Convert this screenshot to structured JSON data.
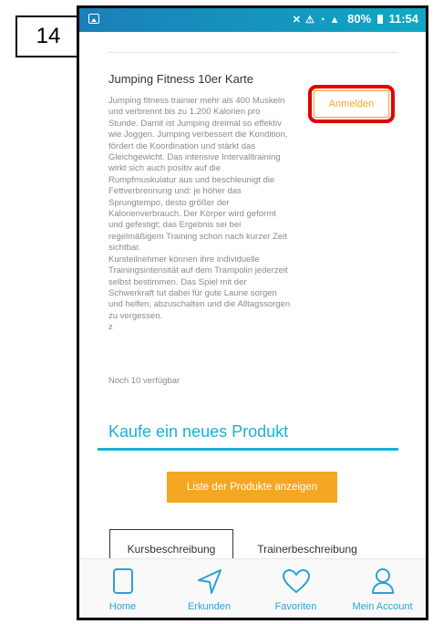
{
  "step_number": "14",
  "statusbar": {
    "signal_icons": "✕ ⚠ ◔ ▲",
    "battery": "80%",
    "time": "11:54"
  },
  "product": {
    "title": "Jumping Fitness 10er Karte",
    "description": "Jumping fitness trainier mehr als 400 Muskeln\nund  verbrennt bis zu 1.200 Kalorien pro\nStunde. Damit ist Jumping dreimal so  effektiv\nwie Joggen. Jumping verbessert die Kondition,\nfördert die  Koordination und stärkt das\nGleichgewicht. Das intensive Intervalltraining\nwirkt  sich auch positiv auf die\nRumpfmuskulatur aus und beschleunigt die\n Fettverbrennung und: je höher das\nSprungtempo, desto größer der\n Kalorienverbrauch. Der Körper wird geformt\nund gefestigt; das Ergebnis sei  bei\nregelmäßigem Training schon nach kurzer Zeit\nsichtbar.\nKursteilnehmer  können ihre individuelle\nTrainingsintensität auf dem Trampolin jederzeit\n selbst bestimmen. Das Spiel mit der\nSchwerkraft tut dabei für gute Laune  sorgen\nund helfen, abzuschalten und die Alltagssorgen\nzu vergessen.\n  z",
    "availability": "Noch 10 verfügbar",
    "register_label": "Anmelden"
  },
  "new_product": {
    "title": "Kaufe ein neues Produkt",
    "list_button": "Liste der Produkte anzeigen"
  },
  "tabs": [
    {
      "label": "Kursbeschreibung",
      "active": true
    },
    {
      "label": "Trainerbeschreibung",
      "active": false
    }
  ],
  "bottom_nav": [
    {
      "label": "Home",
      "icon": "tablet-icon"
    },
    {
      "label": "Erkunden",
      "icon": "navigation-arrow-icon"
    },
    {
      "label": "Favoriten",
      "icon": "heart-icon"
    },
    {
      "label": "Mein Account",
      "icon": "user-icon"
    }
  ],
  "colors": {
    "accent_blue": "#1ab0d8",
    "accent_orange": "#f5a623",
    "highlight_red": "#e00000",
    "statusbar": "#1b7fb8"
  }
}
